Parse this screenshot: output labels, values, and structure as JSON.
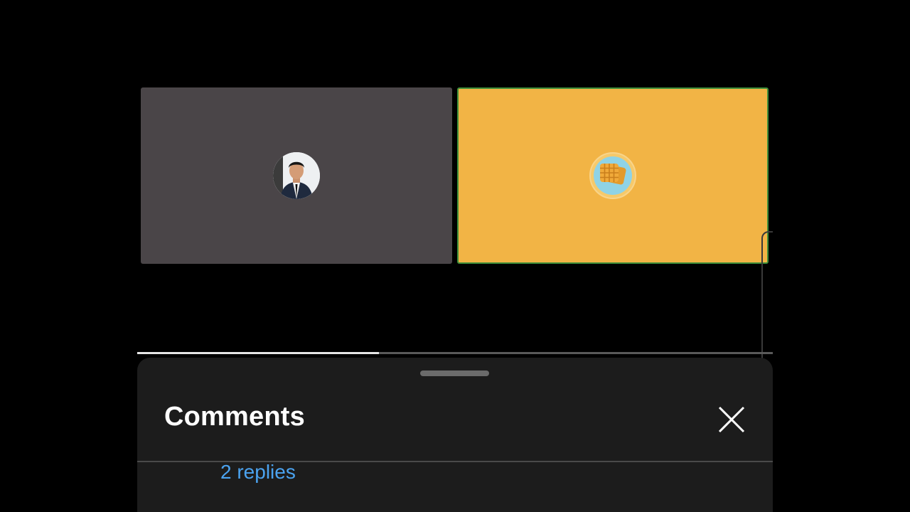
{
  "video": {
    "participants": [
      {
        "name": "participant-person",
        "avatar_icon": "person-avatar-icon",
        "tile_color": "#4a4548"
      },
      {
        "name": "participant-waffle",
        "avatar_icon": "waffle-avatar-icon",
        "tile_color": "#f2b445",
        "active_speaker_border": "#3f8f3a"
      }
    ],
    "progress": 0.38
  },
  "comments": {
    "title": "Comments",
    "close_icon": "close-icon",
    "replies_label": "2 replies"
  },
  "colors": {
    "background": "#000000",
    "sheet": "#1c1c1c",
    "link": "#4ba3f0"
  }
}
